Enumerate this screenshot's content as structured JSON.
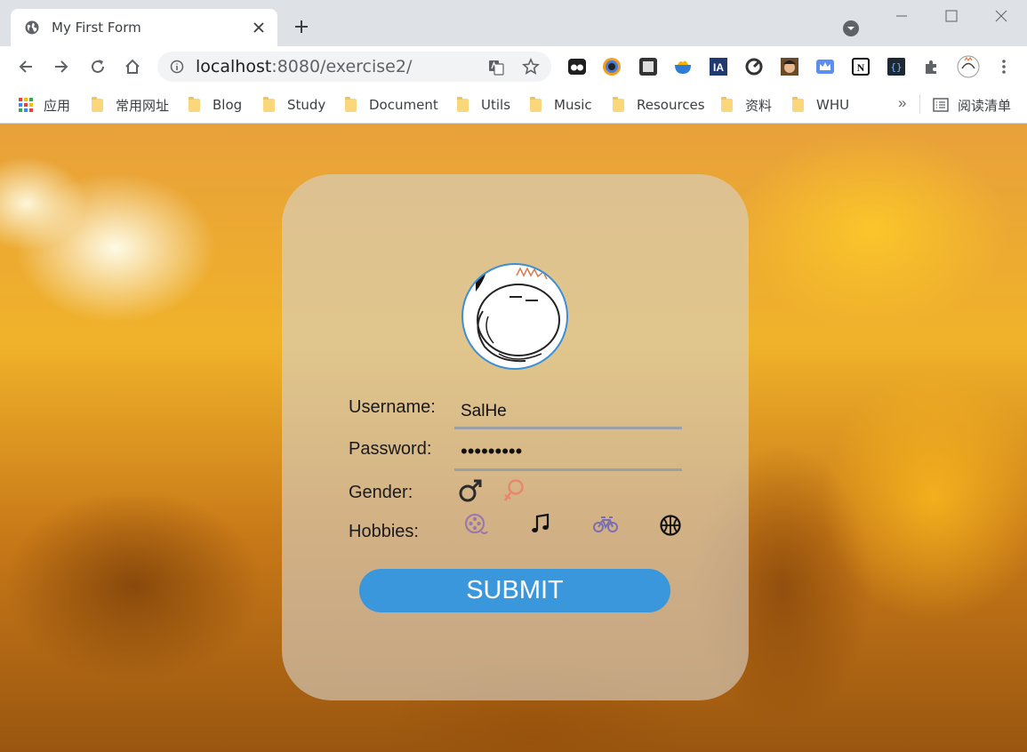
{
  "browser": {
    "tab_title": "My First Form",
    "url_host": "localhost",
    "url_path": ":8080/exercise2/"
  },
  "bookmarks": {
    "items": [
      "应用",
      "常用网址",
      "Blog",
      "Study",
      "Document",
      "Utils",
      "Music",
      "Resources",
      "资料",
      "WHU"
    ],
    "more": "»",
    "reading_list": "阅读清单"
  },
  "form": {
    "username_label": "Username:",
    "username_value": "SalHe",
    "password_label": "Password:",
    "password_value": "•••••••••",
    "gender_label": "Gender:",
    "gender_options": [
      "male",
      "female"
    ],
    "hobbies_label": "Hobbies:",
    "hobbies": [
      "film",
      "music",
      "cycling",
      "basketball"
    ],
    "submit_label": "SUBMIT"
  },
  "colors": {
    "accent": "#3a97dc",
    "avatar_border": "#3a8fd6",
    "female_icon": "#e8866c",
    "male_icon": "#2b2b2b"
  }
}
